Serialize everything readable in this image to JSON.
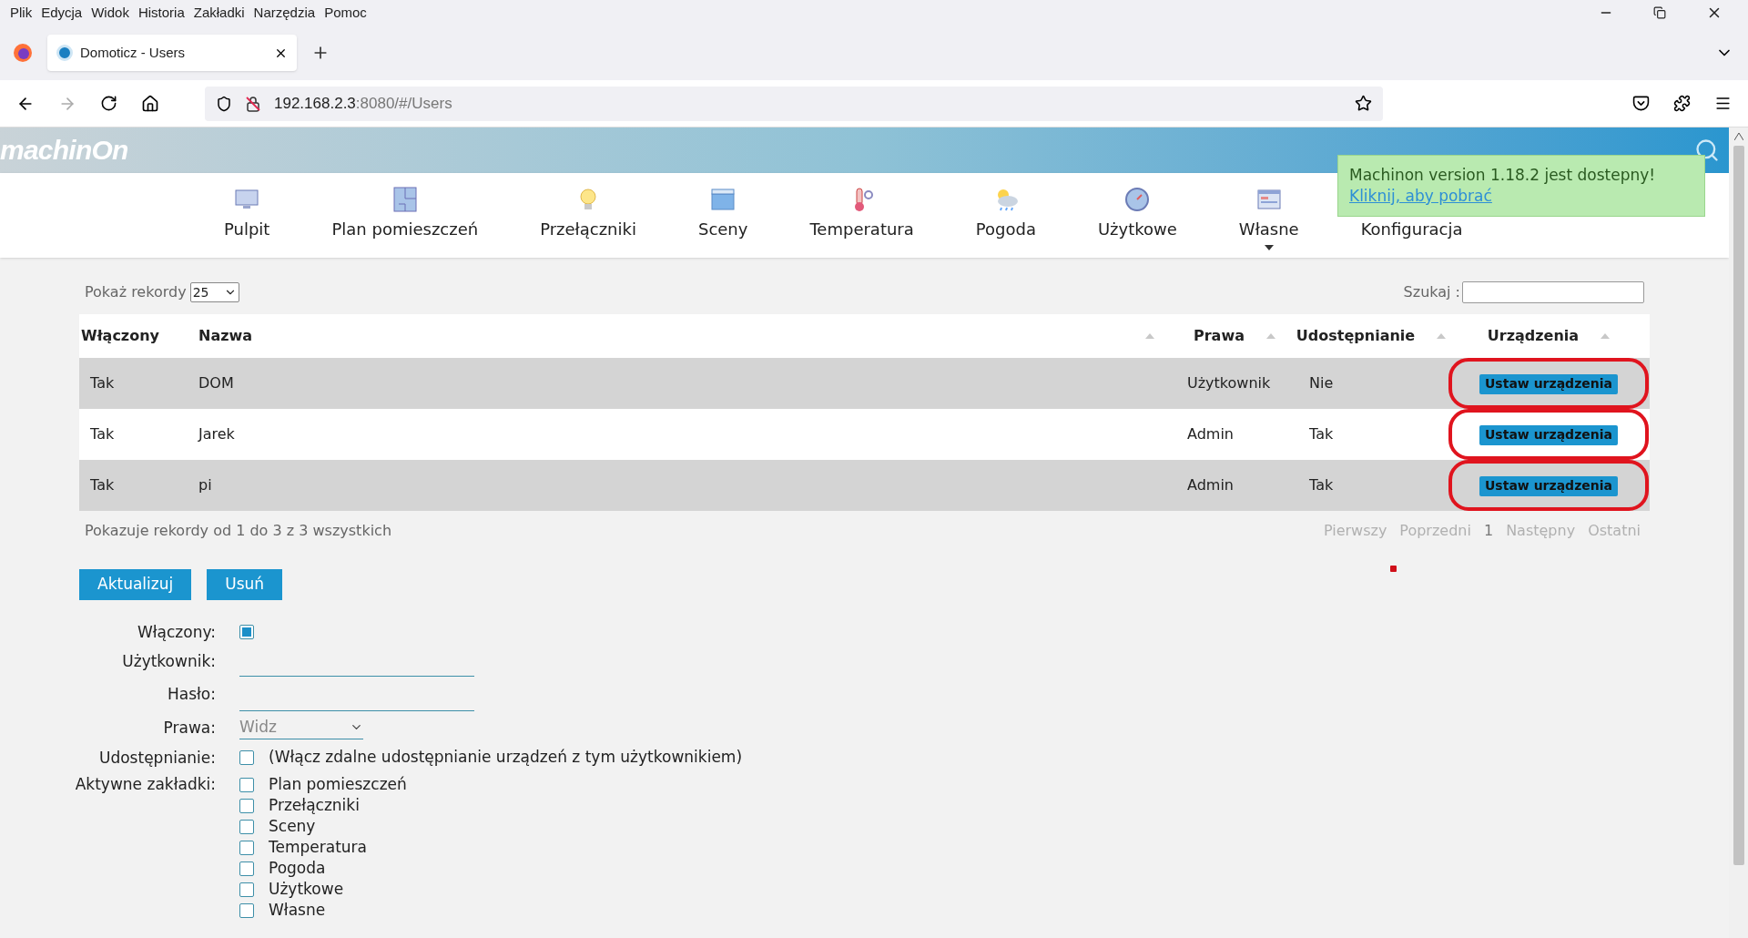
{
  "browser": {
    "menu": [
      "Plik",
      "Edycja",
      "Widok",
      "Historia",
      "Zakładki",
      "Narzędzia",
      "Pomoc"
    ],
    "tab": {
      "title": "Domoticz - Users"
    },
    "url": {
      "host": "192.168.2.3",
      "rest": ":8080/#/Users"
    }
  },
  "header": {
    "logo": "machinOn"
  },
  "nav": [
    {
      "label": "Pulpit",
      "kind": "monitor",
      "dropdown": false
    },
    {
      "label": "Plan pomieszczeń",
      "kind": "plan",
      "dropdown": false
    },
    {
      "label": "Przełączniki",
      "kind": "bulb",
      "dropdown": false
    },
    {
      "label": "Sceny",
      "kind": "clapper",
      "dropdown": false
    },
    {
      "label": "Temperatura",
      "kind": "thermo",
      "dropdown": false
    },
    {
      "label": "Pogoda",
      "kind": "weather",
      "dropdown": false
    },
    {
      "label": "Użytkowe",
      "kind": "gauge",
      "dropdown": false
    },
    {
      "label": "Własne",
      "kind": "window",
      "dropdown": true
    },
    {
      "label": "Konfiguracja",
      "kind": "text",
      "dropdown": false
    }
  ],
  "notification": {
    "text": "Machinon version 1.18.2 jest dostepny! ",
    "link": "Kliknij, aby pobrać"
  },
  "table_controls": {
    "length_label": "Pokaż rekordy",
    "length_value": "25",
    "search_label": "Szukaj :"
  },
  "table": {
    "columns": [
      {
        "label": "Włączony",
        "sortable": false
      },
      {
        "label": "Nazwa",
        "sortable": true
      },
      {
        "label": "Prawa",
        "sortable": true
      },
      {
        "label": "Udostępnianie",
        "sortable": true
      },
      {
        "label": "Urządzenia",
        "sortable": true
      }
    ],
    "rows": [
      {
        "enabled": "Tak",
        "name": "DOM",
        "rights": "Użytkownik",
        "sharing": "Nie",
        "button": "Ustaw urządzenia",
        "highlighted": true
      },
      {
        "enabled": "Tak",
        "name": "Jarek",
        "rights": "Admin",
        "sharing": "Tak",
        "button": "Ustaw urządzenia",
        "highlighted": true
      },
      {
        "enabled": "Tak",
        "name": "pi",
        "rights": "Admin",
        "sharing": "Tak",
        "button": "Ustaw urządzenia",
        "highlighted": true
      }
    ],
    "info": "Pokazuje rekordy od 1 do 3 z 3 wszystkich",
    "pagination": [
      {
        "label": "Pierwszy",
        "selected": false
      },
      {
        "label": "Poprzedni",
        "selected": false
      },
      {
        "label": "1",
        "selected": true
      },
      {
        "label": "Następny",
        "selected": false
      },
      {
        "label": "Ostatni",
        "selected": false
      }
    ]
  },
  "actions": [
    "Aktualizuj",
    "Usuń"
  ],
  "form": {
    "enabled": {
      "label": "Włączony:",
      "checked": true
    },
    "user": {
      "label": "Użytkownik:"
    },
    "password": {
      "label": "Hasło:"
    },
    "rights": {
      "label": "Prawa:",
      "value": "Widz"
    },
    "sharing": {
      "label": "Udostępnianie:",
      "checked": false,
      "text": "(Włącz zdalne udostępnianie urządzeń z tym użytkownikiem)"
    },
    "tabs_label": "Aktywne zakładki:",
    "tabs": [
      {
        "label": "Plan pomieszczeń",
        "checked": false
      },
      {
        "label": "Przełączniki",
        "checked": false
      },
      {
        "label": "Sceny",
        "checked": false
      },
      {
        "label": "Temperatura",
        "checked": false
      },
      {
        "label": "Pogoda",
        "checked": false
      },
      {
        "label": "Użytkowe",
        "checked": false
      },
      {
        "label": "Własne",
        "checked": false
      }
    ]
  }
}
